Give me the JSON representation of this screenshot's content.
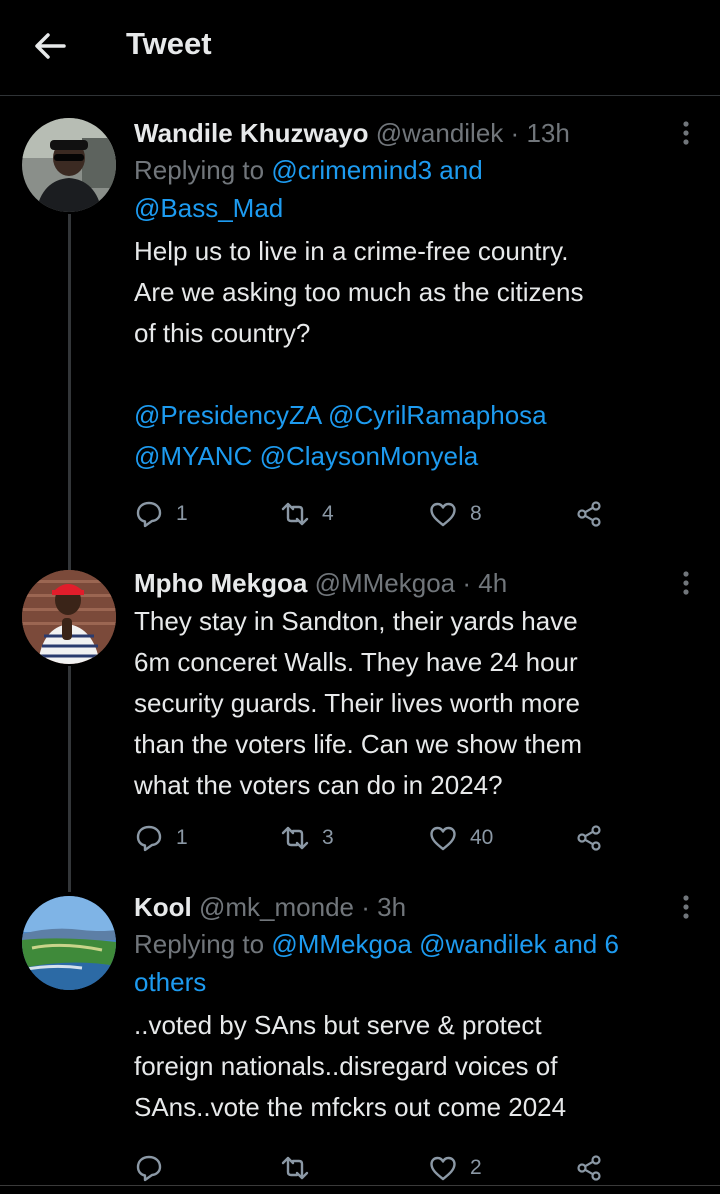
{
  "header": {
    "title": "Tweet"
  },
  "tweets": [
    {
      "author": "Wandile Khuzwayo",
      "handle": "@wandilek",
      "separator": "·",
      "time": "13h",
      "replying_prefix": "Replying to",
      "replying_to": "@crimemind3 and",
      "replying_to_line2": "@Bass_Mad",
      "text_lines": [
        "Help us to live in a crime-free country.",
        "Are we asking too much as the citizens",
        "of this country?"
      ],
      "mention_lines": [
        [
          "@PresidencyZA",
          "@CyrilRamaphosa"
        ],
        [
          "@MYANC",
          "@ClaysonMonyela"
        ]
      ],
      "actions": {
        "reply": "1",
        "retweet": "4",
        "like": "8"
      }
    },
    {
      "author": "Mpho Mekgoa",
      "handle": "@MMekgoa",
      "separator": "·",
      "time": "4h",
      "text_lines": [
        "They stay in Sandton, their yards have",
        "6m conceret Walls. They have 24 hour",
        "security guards. Their lives worth more",
        "than the voters life. Can we show them",
        "what the voters can do in 2024?"
      ],
      "actions": {
        "reply": "1",
        "retweet": "3",
        "like": "40"
      }
    },
    {
      "author": "Kool",
      "handle": "@mk_monde",
      "separator": "·",
      "time": "3h",
      "replying_prefix": "Replying to",
      "replying_to": "@MMekgoa @wandilek and 6",
      "replying_to_line2": "others",
      "text_lines": [
        "..voted by SAns but serve & protect",
        "foreign nationals..disregard voices of",
        "SAns..vote the mfckrs out come 2024"
      ],
      "actions": {
        "reply": "",
        "retweet": "",
        "like": "2"
      }
    }
  ],
  "colors": {
    "background": "#000000",
    "text": "#e7e9ea",
    "muted": "#71767b",
    "link": "#1d9bf0",
    "divider": "#2f3336"
  },
  "icons": [
    "back-arrow-icon",
    "more-vertical-icon",
    "reply-icon",
    "retweet-icon",
    "like-icon",
    "share-icon"
  ]
}
